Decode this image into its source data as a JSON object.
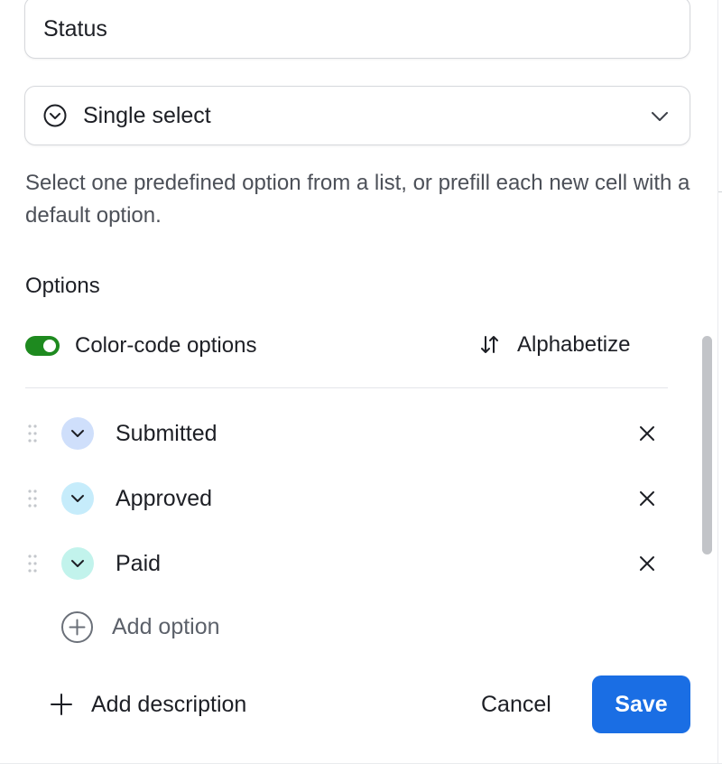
{
  "field": {
    "name_value": "Status"
  },
  "field_type": {
    "label": "Single select",
    "icon": "circle-chevron-down-icon",
    "dropdown_icon": "chevron-down-icon",
    "description": "Select one predefined option from a list, or prefill each new cell with a default option."
  },
  "options_section": {
    "title": "Options",
    "color_code": {
      "label": "Color-code options",
      "enabled": true,
      "color": "#1e8a1f"
    },
    "alphabetize_label": "Alphabetize",
    "items": [
      {
        "label": "Submitted",
        "color": "#cfdffb"
      },
      {
        "label": "Approved",
        "color": "#c6ecfb"
      },
      {
        "label": "Paid",
        "color": "#c2f3ec"
      }
    ],
    "add_option_label": "Add option"
  },
  "footer": {
    "add_description_label": "Add description",
    "cancel_label": "Cancel",
    "save_label": "Save",
    "save_color": "#1a6ee4"
  }
}
